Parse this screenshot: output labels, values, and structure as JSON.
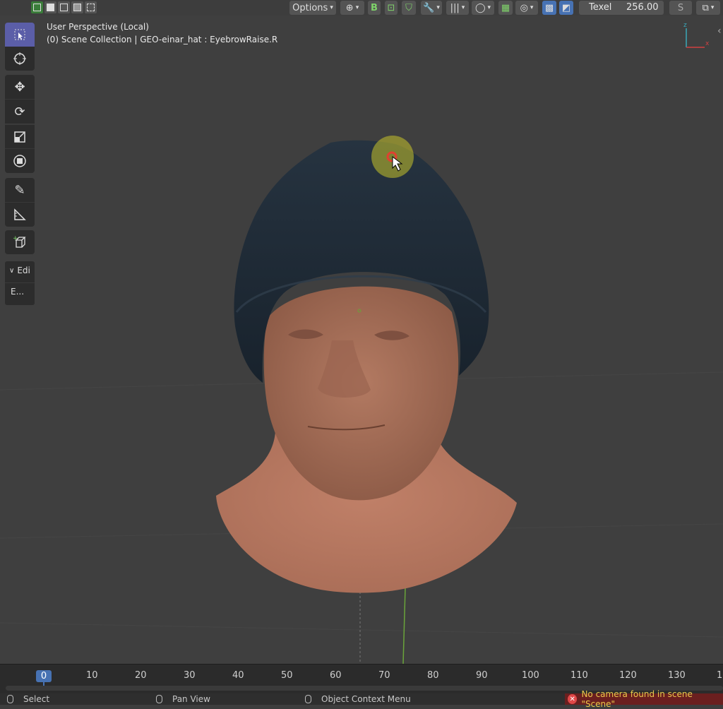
{
  "header": {
    "options_label": "Options",
    "texel_label": "Texel",
    "texel_value": "256.00",
    "s_label": "S"
  },
  "viewport": {
    "perspective": "User Perspective (Local)",
    "collection": "(0) Scene Collection | GEO-einar_hat : EyebrowRaise.R"
  },
  "panel": {
    "edit_label": "Edi",
    "edit_short": "E..."
  },
  "timeline": {
    "current_frame": "0",
    "ticks": [
      "10",
      "20",
      "30",
      "40",
      "50",
      "60",
      "70",
      "80",
      "90",
      "100",
      "110",
      "120",
      "130",
      "1"
    ]
  },
  "status": {
    "select": "Select",
    "pan": "Pan View",
    "context": "Object Context Menu",
    "warning": "No camera found in scene \"Scene\""
  },
  "colors": {
    "accent": "#4772b3",
    "active_tool": "#5b5ea8",
    "skin": "#a8705a",
    "hat": "#1f2a36",
    "warning_text": "#ecc84a"
  }
}
